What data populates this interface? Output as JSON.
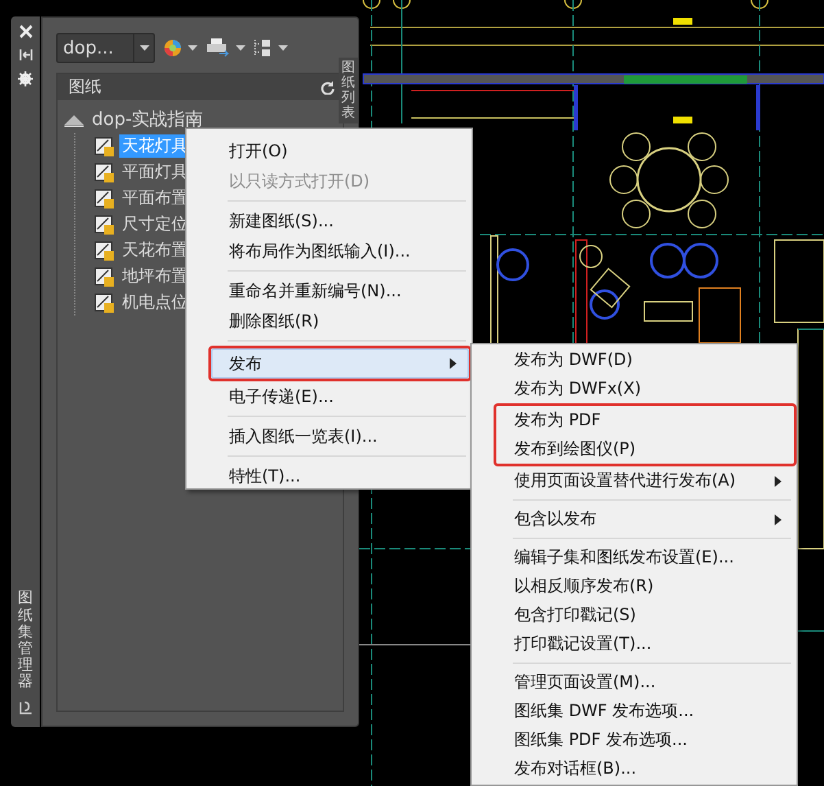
{
  "panel": {
    "title": "图纸集管理器",
    "side_tab": "图纸列表",
    "dropdown": {
      "value": "dop..."
    },
    "section_header": "图纸",
    "tree": {
      "label": "dop-实战指南",
      "children": [
        {
          "label": "天花灯具",
          "selected": true
        },
        {
          "label": "平面灯具",
          "selected": false
        },
        {
          "label": "平面布置",
          "selected": false
        },
        {
          "label": "尺寸定位",
          "selected": false
        },
        {
          "label": "天花布置",
          "selected": false
        },
        {
          "label": "地坪布置",
          "selected": false
        },
        {
          "label": "机电点位",
          "selected": false
        }
      ]
    }
  },
  "context_menu": {
    "groups": [
      [
        {
          "label": "打开(O)",
          "disabled": false,
          "highlighted": false,
          "submenu": false,
          "outlined": false
        },
        {
          "label": "以只读方式打开(D)",
          "disabled": true,
          "highlighted": false,
          "submenu": false,
          "outlined": false
        }
      ],
      [
        {
          "label": "新建图纸(S)...",
          "disabled": false,
          "highlighted": false,
          "submenu": false,
          "outlined": false
        },
        {
          "label": "将布局作为图纸输入(I)...",
          "disabled": false,
          "highlighted": false,
          "submenu": false,
          "outlined": false
        }
      ],
      [
        {
          "label": "重命名并重新编号(N)...",
          "disabled": false,
          "highlighted": false,
          "submenu": false,
          "outlined": false
        },
        {
          "label": "删除图纸(R)",
          "disabled": false,
          "highlighted": false,
          "submenu": false,
          "outlined": false
        }
      ],
      [
        {
          "label": "发布",
          "disabled": false,
          "highlighted": true,
          "submenu": true,
          "outlined": true
        },
        {
          "label": "电子传递(E)...",
          "disabled": false,
          "highlighted": false,
          "submenu": false,
          "outlined": false
        }
      ],
      [
        {
          "label": "插入图纸一览表(I)...",
          "disabled": false,
          "highlighted": false,
          "submenu": false,
          "outlined": false
        }
      ],
      [
        {
          "label": "特性(T)...",
          "disabled": false,
          "highlighted": false,
          "submenu": false,
          "outlined": false
        }
      ]
    ]
  },
  "publish_submenu": {
    "groups": [
      [
        {
          "label": "发布为 DWF(D)",
          "disabled": false,
          "highlighted": false,
          "submenu": false,
          "outlined": false
        },
        {
          "label": "发布为 DWFx(X)",
          "disabled": false,
          "highlighted": false,
          "submenu": false,
          "outlined": false
        },
        {
          "label": "发布为 PDF",
          "disabled": false,
          "highlighted": false,
          "submenu": false,
          "outlined": true
        },
        {
          "label": "发布到绘图仪(P)",
          "disabled": false,
          "highlighted": false,
          "submenu": false,
          "outlined": true
        },
        {
          "label": "使用页面设置替代进行发布(A)",
          "disabled": false,
          "highlighted": false,
          "submenu": true,
          "outlined": false
        }
      ],
      [
        {
          "label": "包含以发布",
          "disabled": false,
          "highlighted": false,
          "submenu": true,
          "outlined": false
        }
      ],
      [
        {
          "label": "编辑子集和图纸发布设置(E)...",
          "disabled": false,
          "highlighted": false,
          "submenu": false,
          "outlined": false
        },
        {
          "label": "以相反顺序发布(R)",
          "disabled": false,
          "highlighted": false,
          "submenu": false,
          "outlined": false
        },
        {
          "label": "包含打印戳记(S)",
          "disabled": false,
          "highlighted": false,
          "submenu": false,
          "outlined": false
        },
        {
          "label": "打印戳记设置(T)...",
          "disabled": false,
          "highlighted": false,
          "submenu": false,
          "outlined": false
        }
      ],
      [
        {
          "label": "管理页面设置(M)...",
          "disabled": false,
          "highlighted": false,
          "submenu": false,
          "outlined": false
        },
        {
          "label": "图纸集 DWF 发布选项...",
          "disabled": false,
          "highlighted": false,
          "submenu": false,
          "outlined": false
        },
        {
          "label": "图纸集 PDF 发布选项...",
          "disabled": false,
          "highlighted": false,
          "submenu": false,
          "outlined": false
        },
        {
          "label": "发布对话框(B)...",
          "disabled": false,
          "highlighted": false,
          "submenu": false,
          "outlined": false
        }
      ]
    ]
  }
}
